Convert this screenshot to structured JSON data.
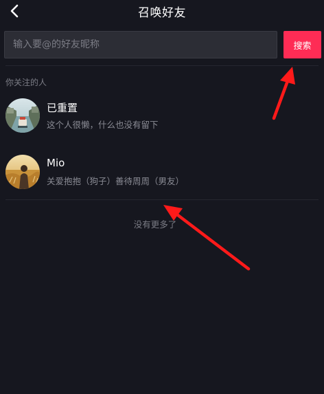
{
  "header": {
    "title": "召唤好友",
    "back_icon": "chevron-left-icon"
  },
  "search": {
    "placeholder": "输入要@的好友昵称",
    "value": "",
    "button_label": "搜索"
  },
  "colors": {
    "background": "#16171f",
    "accent": "#fe2c55",
    "annotation_arrow": "#ff1a1a"
  },
  "following": {
    "section_label": "你关注的人",
    "users": [
      {
        "name": "已重置",
        "bio": "这个人很懒，什么也没有留下"
      },
      {
        "name": "Mio",
        "bio": "关爱抱抱（狗子）善待周周（男友）"
      }
    ]
  },
  "footer": {
    "no_more": "没有更多了"
  }
}
